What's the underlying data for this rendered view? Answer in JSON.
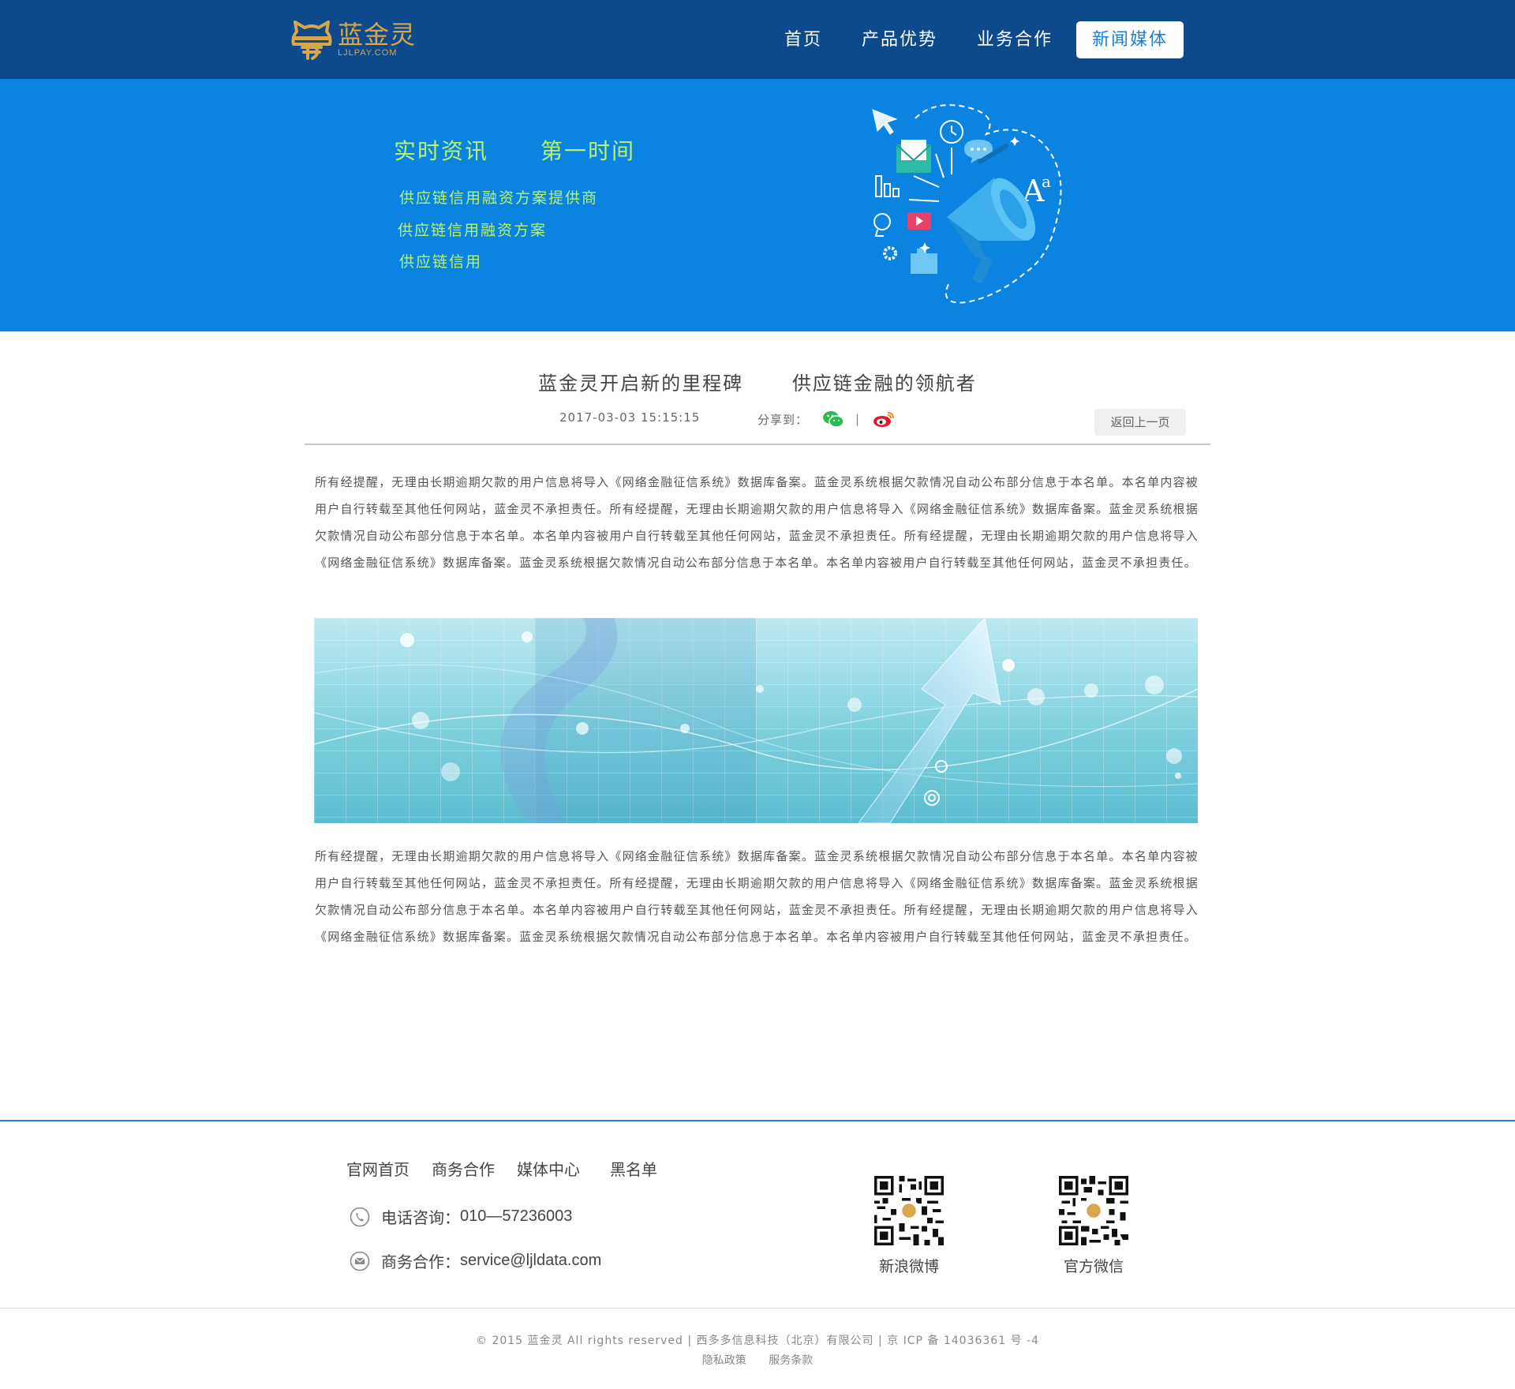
{
  "header": {
    "logo_name": "蓝金灵",
    "logo_domain": "LJLPAY.COM",
    "nav": [
      {
        "label": "首页"
      },
      {
        "label": "产品优势"
      },
      {
        "label": "业务合作"
      },
      {
        "label": "新闻媒体",
        "active": true
      }
    ]
  },
  "banner": {
    "title_left": "实时资讯",
    "title_right": "第一时间",
    "lines": [
      "供应链信用融资方案提供商",
      "供应链信用融资方案",
      "供应链信用"
    ]
  },
  "article": {
    "title_left": "蓝金灵开启新的里程碑",
    "title_right": "供应链金融的领航者",
    "date": "2017-03-03  15:15:15",
    "share_label": "分享到：",
    "share_separator": "|",
    "share_icons": [
      "wechat-icon",
      "weibo-icon"
    ],
    "back_label": "返回上一页",
    "paragraphs": [
      "所有经提醒，无理由长期逾期欠款的用户信息将导入《网络金融征信系统》数据库备案。蓝金灵系统根据欠款情况自动公布部分信息于本名单。本名单内容被用户自行转载至其他任何网站，蓝金灵不承担责任。所有经提醒，无理由长期逾期欠款的用户信息将导入《网络金融征信系统》数据库备案。蓝金灵系统根据欠款情况自动公布部分信息于本名单。本名单内容被用户自行转载至其他任何网站，蓝金灵不承担责任。所有经提醒，无理由长期逾期欠款的用户信息将导入《网络金融征信系统》数据库备案。蓝金灵系统根据欠款情况自动公布部分信息于本名单。本名单内容被用户自行转载至其他任何网站，蓝金灵不承担责任。",
      "所有经提醒，无理由长期逾期欠款的用户信息将导入《网络金融征信系统》数据库备案。蓝金灵系统根据欠款情况自动公布部分信息于本名单。本名单内容被用户自行转载至其他任何网站，蓝金灵不承担责任。所有经提醒，无理由长期逾期欠款的用户信息将导入《网络金融征信系统》数据库备案。蓝金灵系统根据欠款情况自动公布部分信息于本名单。本名单内容被用户自行转载至其他任何网站，蓝金灵不承担责任。所有经提醒，无理由长期逾期欠款的用户信息将导入《网络金融征信系统》数据库备案。蓝金灵系统根据欠款情况自动公布部分信息于本名单。本名单内容被用户自行转载至其他任何网站，蓝金灵不承担责任。"
    ]
  },
  "footer": {
    "links": [
      "官网首页",
      "商务合作",
      "媒体中心",
      "黑名单"
    ],
    "phone_label": "电话咨询：",
    "phone_value": "010—57236003",
    "mail_label": "商务合作：",
    "mail_value": "service@ljldata.com",
    "qr_weibo_label": "新浪微博",
    "qr_wechat_label": "官方微信",
    "copyright": "© 2015 蓝金灵 All rights reserved | 西多多信息科技（北京）有限公司 | 京 ICP 备 14036361 号 -4",
    "legal": [
      "隐私政策",
      "服务条款"
    ]
  },
  "colors": {
    "header_bg": "#0d4a8b",
    "banner_bg": "#0a84e0",
    "banner_text": "#b9f36e",
    "logo_gold": "#d8a64b",
    "nav_active_text": "#1a7fd6",
    "footer_rule": "#2a7fc9"
  }
}
